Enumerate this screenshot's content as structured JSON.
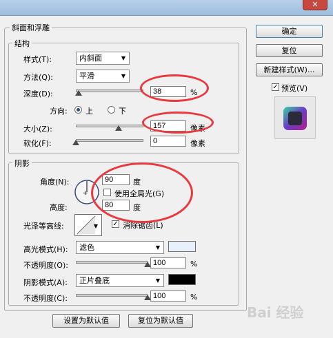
{
  "dialog": {
    "close_glyph": "✕"
  },
  "bevel": {
    "group_title": "斜面和浮雕",
    "structure": {
      "title": "结构",
      "style_label": "样式(T):",
      "style_value": "内斜面",
      "method_label": "方法(Q):",
      "method_value": "平滑",
      "depth_label": "深度(D):",
      "depth_value": "38",
      "depth_unit": "%",
      "depth_level": 0.04,
      "direction_label": "方向:",
      "dir_up": "上",
      "dir_down": "下",
      "size_label": "大小(Z):",
      "size_value": "157",
      "size_unit": "像素",
      "size_level": 0.63,
      "soften_label": "软化(F):",
      "soften_value": "0",
      "soften_unit": "像素",
      "soften_level": 0.0
    },
    "shading": {
      "title": "阴影",
      "angle_label": "角度(N):",
      "angle_value": "90",
      "angle_unit": "度",
      "global_light_label": "使用全局光(G)",
      "altitude_label": "高度:",
      "altitude_value": "80",
      "altitude_unit": "度",
      "gloss_label": "光泽等高线:",
      "antialias_label": "消除锯齿(L)",
      "highlight_mode_label": "高光模式(H):",
      "highlight_mode_value": "滤色",
      "highlight_color": "#e8f0fc",
      "highlight_opacity_label": "不透明度(O):",
      "highlight_opacity_value": "100",
      "highlight_opacity_unit": "%",
      "shadow_mode_label": "阴影模式(A):",
      "shadow_mode_value": "正片叠底",
      "shadow_color": "#000000",
      "shadow_opacity_label": "不透明度(C):",
      "shadow_opacity_value": "100",
      "shadow_opacity_unit": "%"
    },
    "make_default": "设置为默认值",
    "reset_default": "复位为默认值"
  },
  "side": {
    "ok": "确定",
    "reset": "复位",
    "new_style": "新建样式(W)...",
    "preview": "预览(V)"
  },
  "watermark": "Bai 经验"
}
